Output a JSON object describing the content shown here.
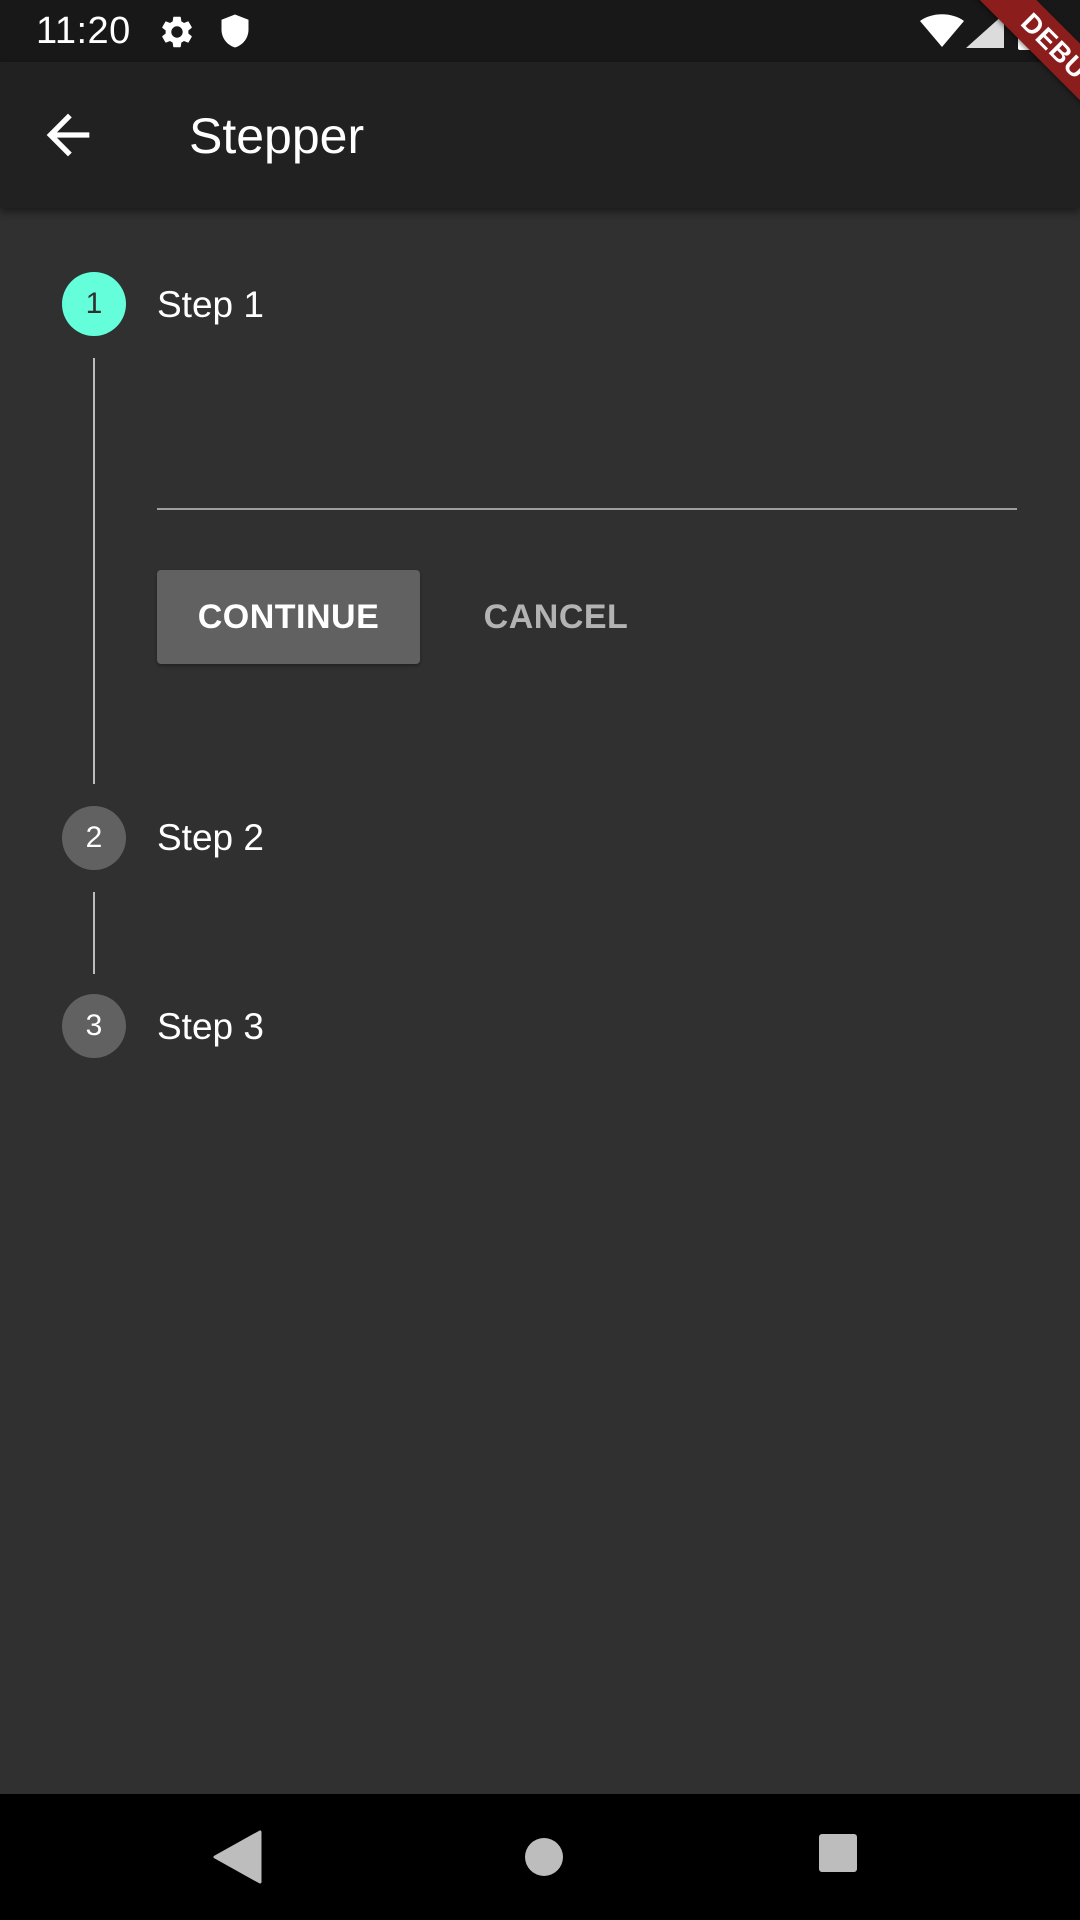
{
  "status_bar": {
    "time": "11:20",
    "icons": [
      "gear-icon",
      "shield-icon",
      "wifi-icon",
      "signal-icon",
      "battery-icon"
    ]
  },
  "debug_banner": {
    "label": "DEBUG",
    "color": "#8c1d1d"
  },
  "app_bar": {
    "title": "Stepper",
    "back_icon": "arrow-back-icon"
  },
  "stepper": {
    "accent_color": "#64ffda",
    "inactive_color": "#616161",
    "steps": [
      {
        "number": "1",
        "title": "Step 1",
        "state": "active"
      },
      {
        "number": "2",
        "title": "Step 2",
        "state": "inactive"
      },
      {
        "number": "3",
        "title": "Step 3",
        "state": "inactive"
      }
    ],
    "step1_field": {
      "value": "",
      "placeholder": ""
    },
    "continue_label": "CONTINUE",
    "cancel_label": "CANCEL"
  },
  "nav_bar": {
    "icons": [
      "nav-back-icon",
      "nav-home-icon",
      "nav-recents-icon"
    ]
  }
}
